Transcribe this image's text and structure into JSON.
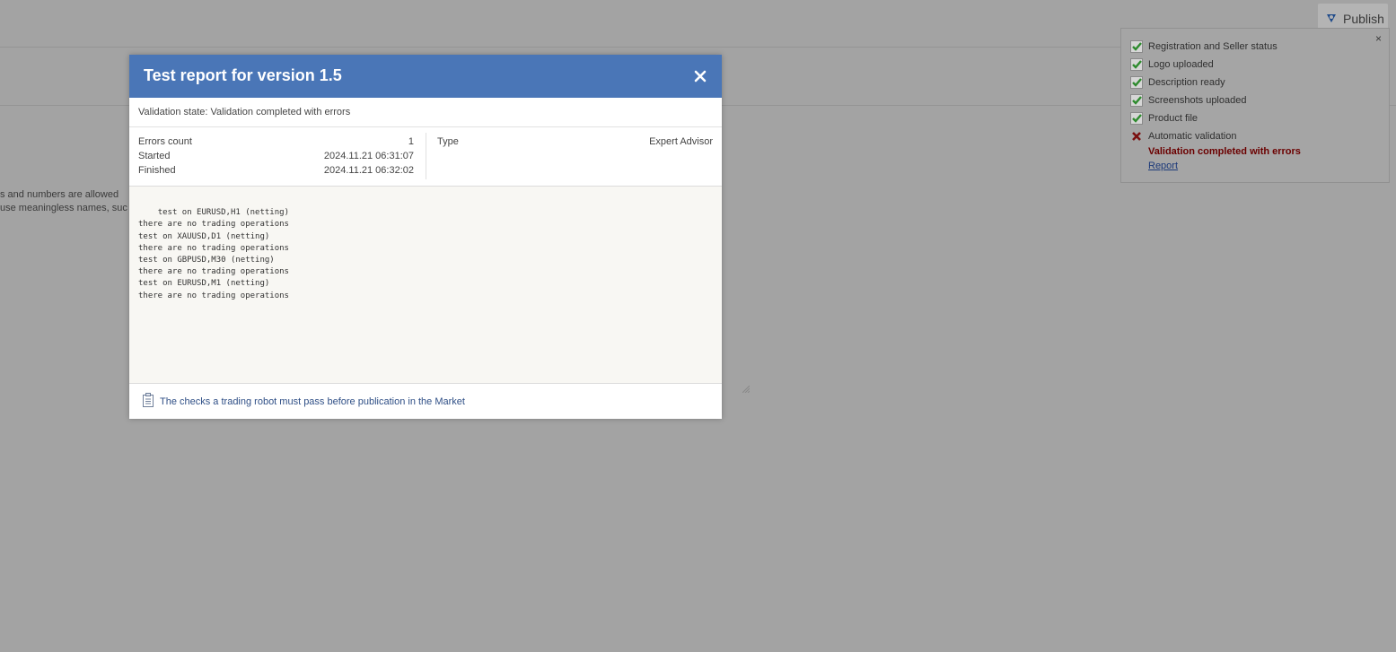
{
  "background": {
    "text_line1": "s and numbers are allowed",
    "text_line2": "use meaningless names, suc",
    "publish_label": "Publish"
  },
  "checklist": {
    "close_symbol": "×",
    "items": [
      {
        "label": "Registration and Seller status",
        "status": "ok"
      },
      {
        "label": "Logo uploaded",
        "status": "ok"
      },
      {
        "label": "Description ready",
        "status": "ok"
      },
      {
        "label": "Screenshots uploaded",
        "status": "ok"
      },
      {
        "label": "Product file",
        "status": "ok"
      },
      {
        "label": "Automatic validation",
        "status": "error"
      }
    ],
    "validation_status": "Validation completed with errors",
    "report_link": "Report"
  },
  "modal": {
    "title": "Test report for version 1.5",
    "validation_state": "Validation state: Validation completed with errors",
    "errors_count_label": "Errors count",
    "errors_count_value": "1",
    "started_label": "Started",
    "started_value": "2024.11.21 06:31:07",
    "finished_label": "Finished",
    "finished_value": "2024.11.21 06:32:02",
    "type_label": "Type",
    "type_value": "Expert Advisor",
    "log": "test on EURUSD,H1 (netting)\nthere are no trading operations\ntest on XAUUSD,D1 (netting)\nthere are no trading operations\ntest on GBPUSD,M30 (netting)\nthere are no trading operations\ntest on EURUSD,M1 (netting)\nthere are no trading operations",
    "footer_link": "The checks a trading robot must pass before publication in the Market"
  },
  "colors": {
    "overlay": "#a3a3a3",
    "modal_header": "#4a76b7",
    "error_text": "#6b0000",
    "check_green": "#2e8b2e",
    "error_x": "#7a1010"
  }
}
